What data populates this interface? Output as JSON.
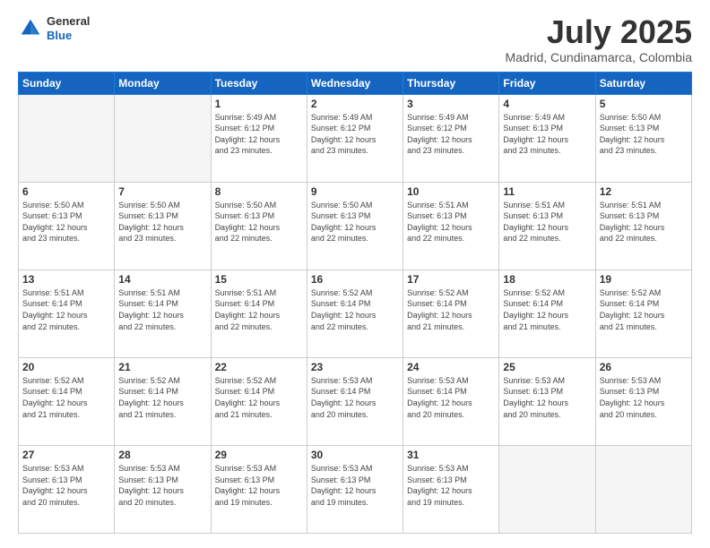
{
  "header": {
    "logo": {
      "general": "General",
      "blue": "Blue"
    },
    "title": "July 2025",
    "location": "Madrid, Cundinamarca, Colombia"
  },
  "calendar": {
    "weekdays": [
      "Sunday",
      "Monday",
      "Tuesday",
      "Wednesday",
      "Thursday",
      "Friday",
      "Saturday"
    ],
    "weeks": [
      [
        {
          "day": "",
          "info": ""
        },
        {
          "day": "",
          "info": ""
        },
        {
          "day": "1",
          "info": "Sunrise: 5:49 AM\nSunset: 6:12 PM\nDaylight: 12 hours\nand 23 minutes."
        },
        {
          "day": "2",
          "info": "Sunrise: 5:49 AM\nSunset: 6:12 PM\nDaylight: 12 hours\nand 23 minutes."
        },
        {
          "day": "3",
          "info": "Sunrise: 5:49 AM\nSunset: 6:12 PM\nDaylight: 12 hours\nand 23 minutes."
        },
        {
          "day": "4",
          "info": "Sunrise: 5:49 AM\nSunset: 6:13 PM\nDaylight: 12 hours\nand 23 minutes."
        },
        {
          "day": "5",
          "info": "Sunrise: 5:50 AM\nSunset: 6:13 PM\nDaylight: 12 hours\nand 23 minutes."
        }
      ],
      [
        {
          "day": "6",
          "info": "Sunrise: 5:50 AM\nSunset: 6:13 PM\nDaylight: 12 hours\nand 23 minutes."
        },
        {
          "day": "7",
          "info": "Sunrise: 5:50 AM\nSunset: 6:13 PM\nDaylight: 12 hours\nand 23 minutes."
        },
        {
          "day": "8",
          "info": "Sunrise: 5:50 AM\nSunset: 6:13 PM\nDaylight: 12 hours\nand 22 minutes."
        },
        {
          "day": "9",
          "info": "Sunrise: 5:50 AM\nSunset: 6:13 PM\nDaylight: 12 hours\nand 22 minutes."
        },
        {
          "day": "10",
          "info": "Sunrise: 5:51 AM\nSunset: 6:13 PM\nDaylight: 12 hours\nand 22 minutes."
        },
        {
          "day": "11",
          "info": "Sunrise: 5:51 AM\nSunset: 6:13 PM\nDaylight: 12 hours\nand 22 minutes."
        },
        {
          "day": "12",
          "info": "Sunrise: 5:51 AM\nSunset: 6:13 PM\nDaylight: 12 hours\nand 22 minutes."
        }
      ],
      [
        {
          "day": "13",
          "info": "Sunrise: 5:51 AM\nSunset: 6:14 PM\nDaylight: 12 hours\nand 22 minutes."
        },
        {
          "day": "14",
          "info": "Sunrise: 5:51 AM\nSunset: 6:14 PM\nDaylight: 12 hours\nand 22 minutes."
        },
        {
          "day": "15",
          "info": "Sunrise: 5:51 AM\nSunset: 6:14 PM\nDaylight: 12 hours\nand 22 minutes."
        },
        {
          "day": "16",
          "info": "Sunrise: 5:52 AM\nSunset: 6:14 PM\nDaylight: 12 hours\nand 22 minutes."
        },
        {
          "day": "17",
          "info": "Sunrise: 5:52 AM\nSunset: 6:14 PM\nDaylight: 12 hours\nand 21 minutes."
        },
        {
          "day": "18",
          "info": "Sunrise: 5:52 AM\nSunset: 6:14 PM\nDaylight: 12 hours\nand 21 minutes."
        },
        {
          "day": "19",
          "info": "Sunrise: 5:52 AM\nSunset: 6:14 PM\nDaylight: 12 hours\nand 21 minutes."
        }
      ],
      [
        {
          "day": "20",
          "info": "Sunrise: 5:52 AM\nSunset: 6:14 PM\nDaylight: 12 hours\nand 21 minutes."
        },
        {
          "day": "21",
          "info": "Sunrise: 5:52 AM\nSunset: 6:14 PM\nDaylight: 12 hours\nand 21 minutes."
        },
        {
          "day": "22",
          "info": "Sunrise: 5:52 AM\nSunset: 6:14 PM\nDaylight: 12 hours\nand 21 minutes."
        },
        {
          "day": "23",
          "info": "Sunrise: 5:53 AM\nSunset: 6:14 PM\nDaylight: 12 hours\nand 20 minutes."
        },
        {
          "day": "24",
          "info": "Sunrise: 5:53 AM\nSunset: 6:14 PM\nDaylight: 12 hours\nand 20 minutes."
        },
        {
          "day": "25",
          "info": "Sunrise: 5:53 AM\nSunset: 6:13 PM\nDaylight: 12 hours\nand 20 minutes."
        },
        {
          "day": "26",
          "info": "Sunrise: 5:53 AM\nSunset: 6:13 PM\nDaylight: 12 hours\nand 20 minutes."
        }
      ],
      [
        {
          "day": "27",
          "info": "Sunrise: 5:53 AM\nSunset: 6:13 PM\nDaylight: 12 hours\nand 20 minutes."
        },
        {
          "day": "28",
          "info": "Sunrise: 5:53 AM\nSunset: 6:13 PM\nDaylight: 12 hours\nand 20 minutes."
        },
        {
          "day": "29",
          "info": "Sunrise: 5:53 AM\nSunset: 6:13 PM\nDaylight: 12 hours\nand 19 minutes."
        },
        {
          "day": "30",
          "info": "Sunrise: 5:53 AM\nSunset: 6:13 PM\nDaylight: 12 hours\nand 19 minutes."
        },
        {
          "day": "31",
          "info": "Sunrise: 5:53 AM\nSunset: 6:13 PM\nDaylight: 12 hours\nand 19 minutes."
        },
        {
          "day": "",
          "info": ""
        },
        {
          "day": "",
          "info": ""
        }
      ]
    ]
  }
}
